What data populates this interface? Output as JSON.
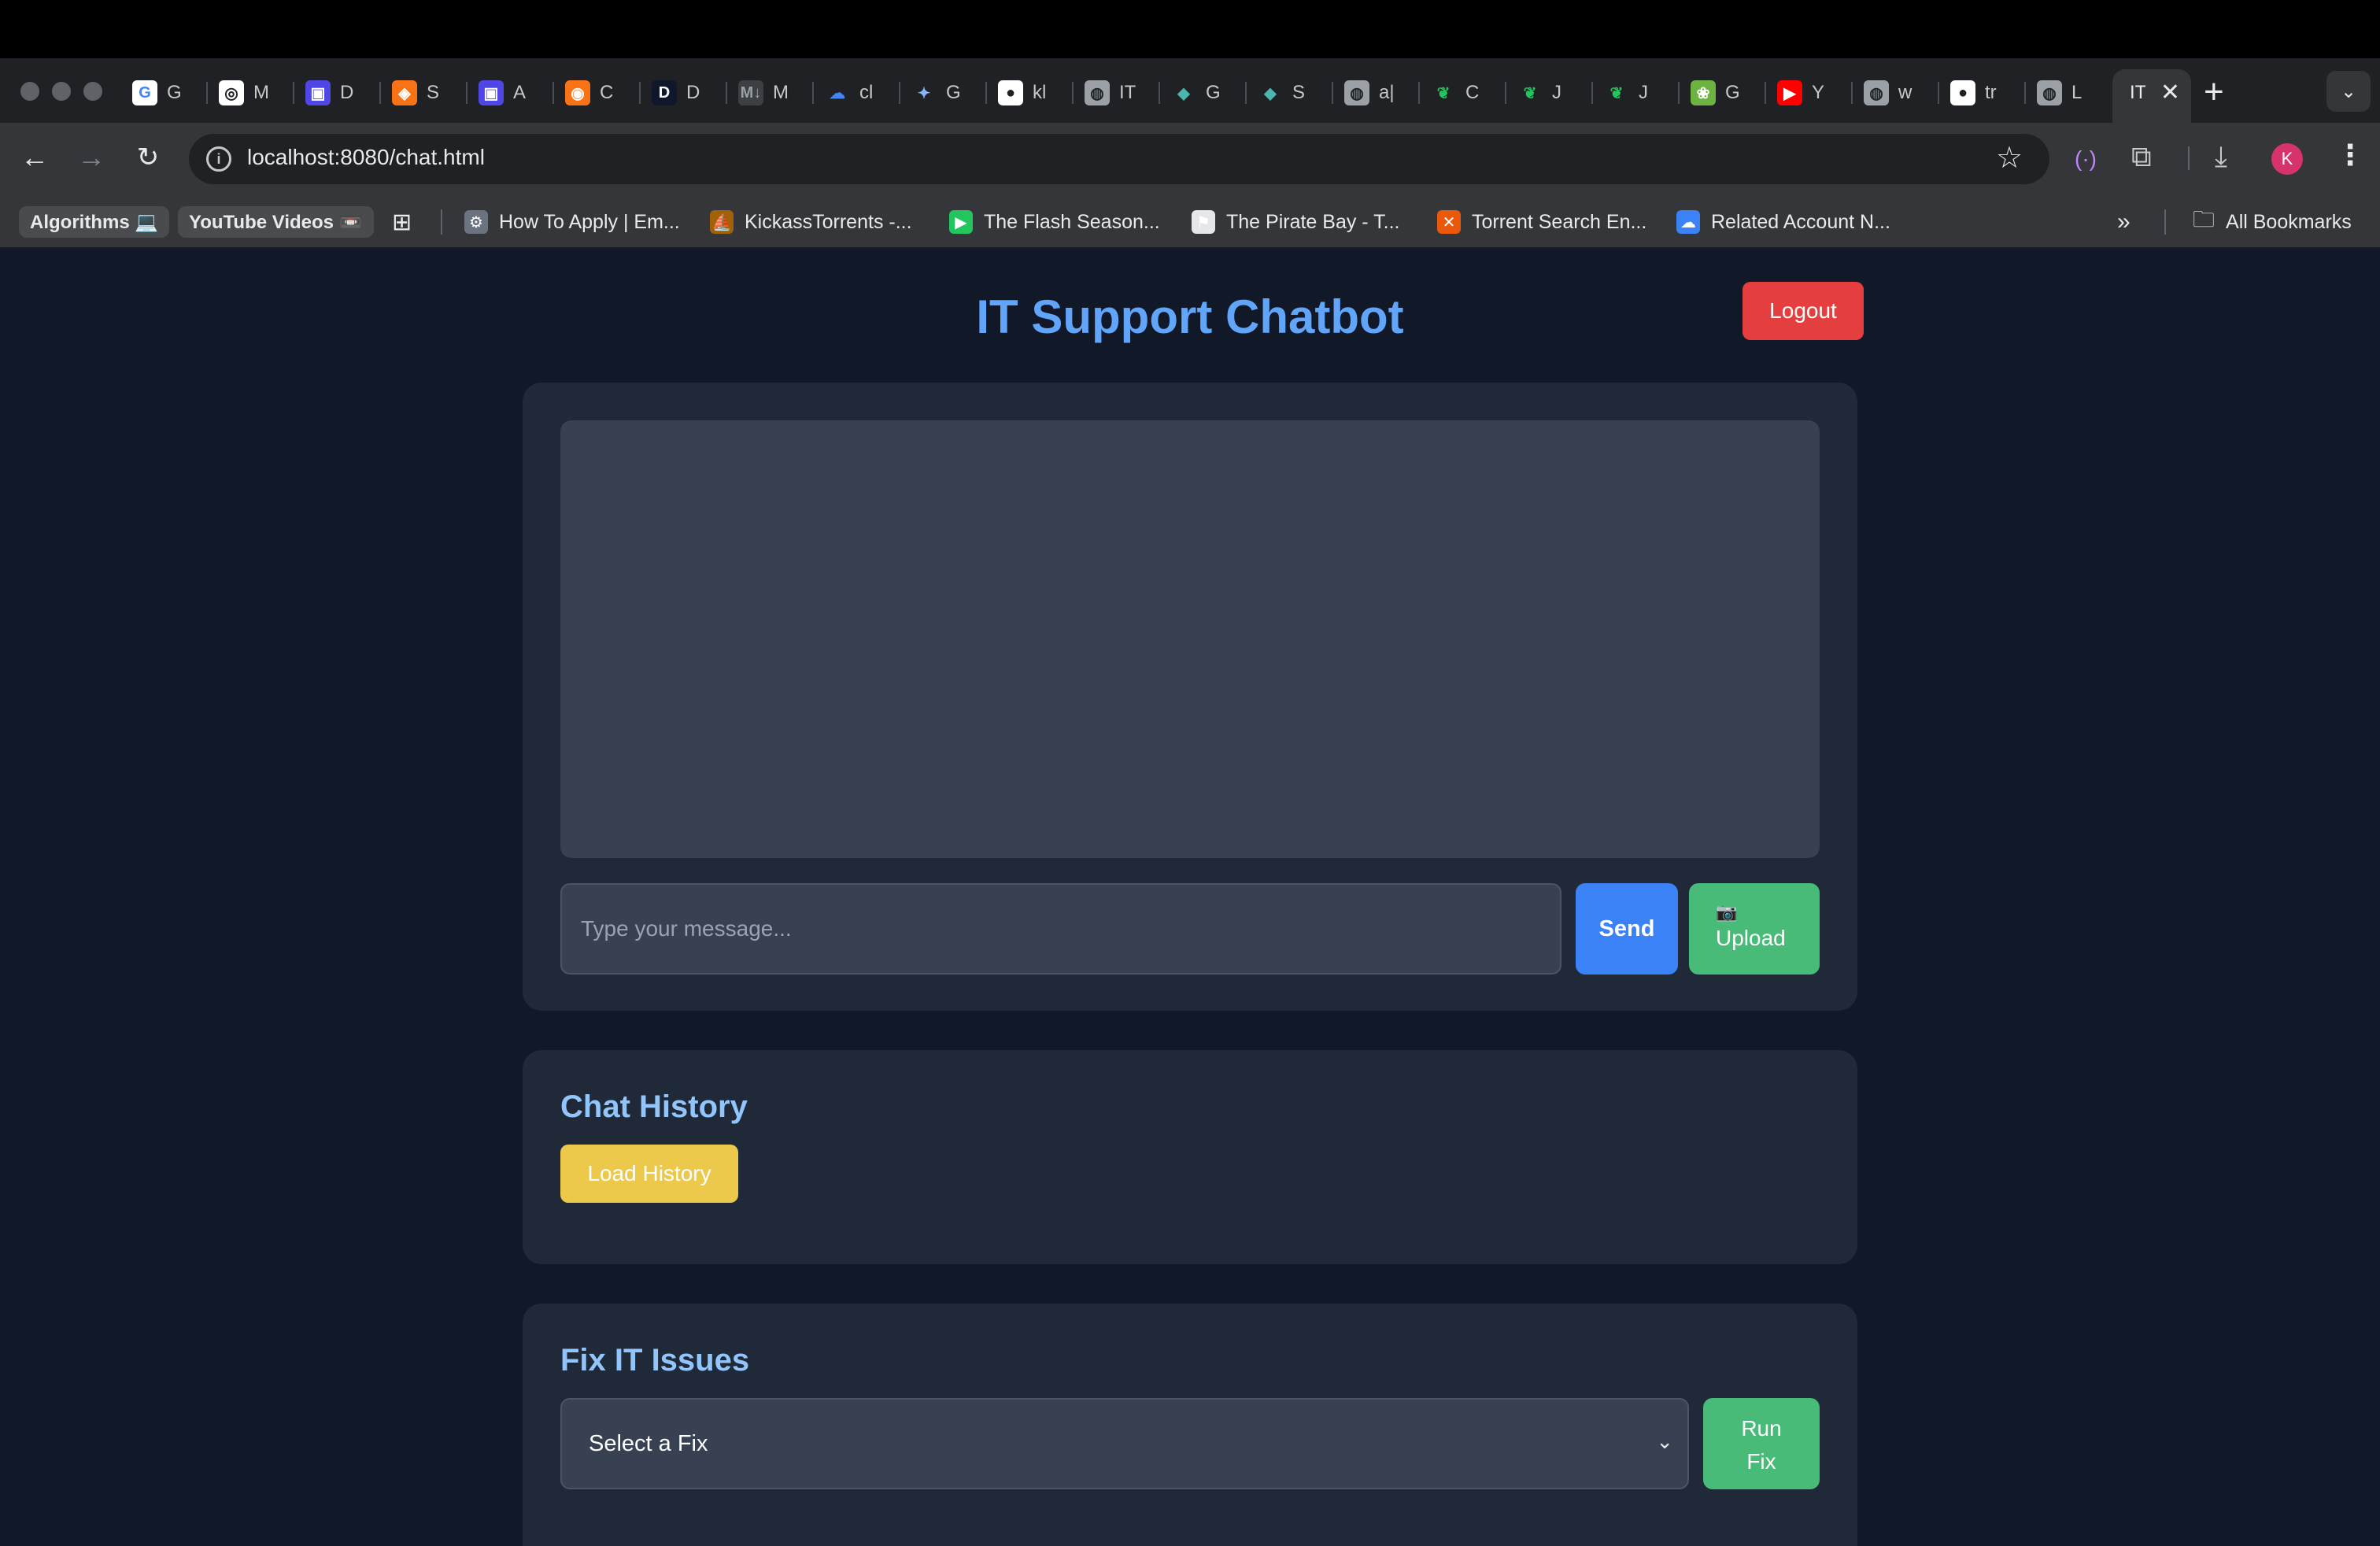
{
  "browser": {
    "tabs": [
      {
        "fav": "G",
        "label": "G",
        "bg": "#ffffff",
        "fg": "#4285f4"
      },
      {
        "fav": "◎",
        "label": "M",
        "bg": "#ffffff",
        "fg": "#202124"
      },
      {
        "fav": "▣",
        "label": "D",
        "bg": "#4f46e5",
        "fg": "#ffffff"
      },
      {
        "fav": "◈",
        "label": "S",
        "bg": "#f97316",
        "fg": "#ffffff"
      },
      {
        "fav": "▣",
        "label": "A",
        "bg": "#4f46e5",
        "fg": "#ffffff"
      },
      {
        "fav": "◉",
        "label": "C",
        "bg": "#f97316",
        "fg": "#ffffff"
      },
      {
        "fav": "D",
        "label": "D",
        "bg": "#0f172a",
        "fg": "#ffffff"
      },
      {
        "fav": "M↓",
        "label": "M",
        "bg": "#3c4043",
        "fg": "#9aa0a6"
      },
      {
        "fav": "☁",
        "label": "cl",
        "bg": "#202124",
        "fg": "#4285f4"
      },
      {
        "fav": "✦",
        "label": "G",
        "bg": "#202124",
        "fg": "#8ab4f8"
      },
      {
        "fav": "●",
        "label": "kl",
        "bg": "#ffffff",
        "fg": "#202124"
      },
      {
        "fav": "◍",
        "label": "IT",
        "bg": "#9aa0a6",
        "fg": "#202124"
      },
      {
        "fav": "◆",
        "label": "G",
        "bg": "#202124",
        "fg": "#4db6ac"
      },
      {
        "fav": "◆",
        "label": "S",
        "bg": "#202124",
        "fg": "#4db6ac"
      },
      {
        "fav": "◍",
        "label": "a|",
        "bg": "#9aa0a6",
        "fg": "#202124"
      },
      {
        "fav": "❦",
        "label": "C",
        "bg": "#202124",
        "fg": "#22c55e"
      },
      {
        "fav": "❦",
        "label": "J",
        "bg": "#202124",
        "fg": "#22c55e"
      },
      {
        "fav": "❦",
        "label": "J",
        "bg": "#202124",
        "fg": "#22c55e"
      },
      {
        "fav": "❀",
        "label": "G",
        "bg": "#6db33f",
        "fg": "#ffffff"
      },
      {
        "fav": "▶",
        "label": "Y",
        "bg": "#ff0000",
        "fg": "#ffffff"
      },
      {
        "fav": "◍",
        "label": "w",
        "bg": "#9aa0a6",
        "fg": "#202124"
      },
      {
        "fav": "●",
        "label": "tr",
        "bg": "#ffffff",
        "fg": "#202124"
      },
      {
        "fav": "◍",
        "label": "L",
        "bg": "#9aa0a6",
        "fg": "#202124"
      }
    ],
    "active_tab_label": "IT",
    "url": "localhost:8080/chat.html",
    "profile_initial": "K",
    "bookmark_chips": [
      "Algorithms 💻",
      "YouTube Videos 📼"
    ],
    "bookmarks": [
      {
        "icon": "⚙",
        "label": "How To Apply | Em...",
        "bg": "#6b7280"
      },
      {
        "icon": "⛵",
        "label": "KickassTorrents -...",
        "bg": "#a16207"
      },
      {
        "icon": "▶",
        "label": "The Flash Season...",
        "bg": "#22c55e"
      },
      {
        "icon": "⚑",
        "label": "The Pirate Bay - T...",
        "bg": "#e5e7eb"
      },
      {
        "icon": "✕",
        "label": "Torrent Search En...",
        "bg": "#ea580c"
      },
      {
        "icon": "☁",
        "label": "Related Account N...",
        "bg": "#3b82f6"
      }
    ],
    "all_bookmarks": "All Bookmarks"
  },
  "app": {
    "title": "IT Support Chatbot",
    "logout_label": "Logout",
    "chat": {
      "input_placeholder": "Type your message...",
      "send_label": "Send",
      "upload_icon": "📷",
      "upload_label": "Upload"
    },
    "history": {
      "heading": "Chat History",
      "load_label": "Load History"
    },
    "fix": {
      "heading": "Fix IT Issues",
      "select_value": "Select a Fix",
      "run_line1": "Run",
      "run_line2": "Fix"
    }
  }
}
